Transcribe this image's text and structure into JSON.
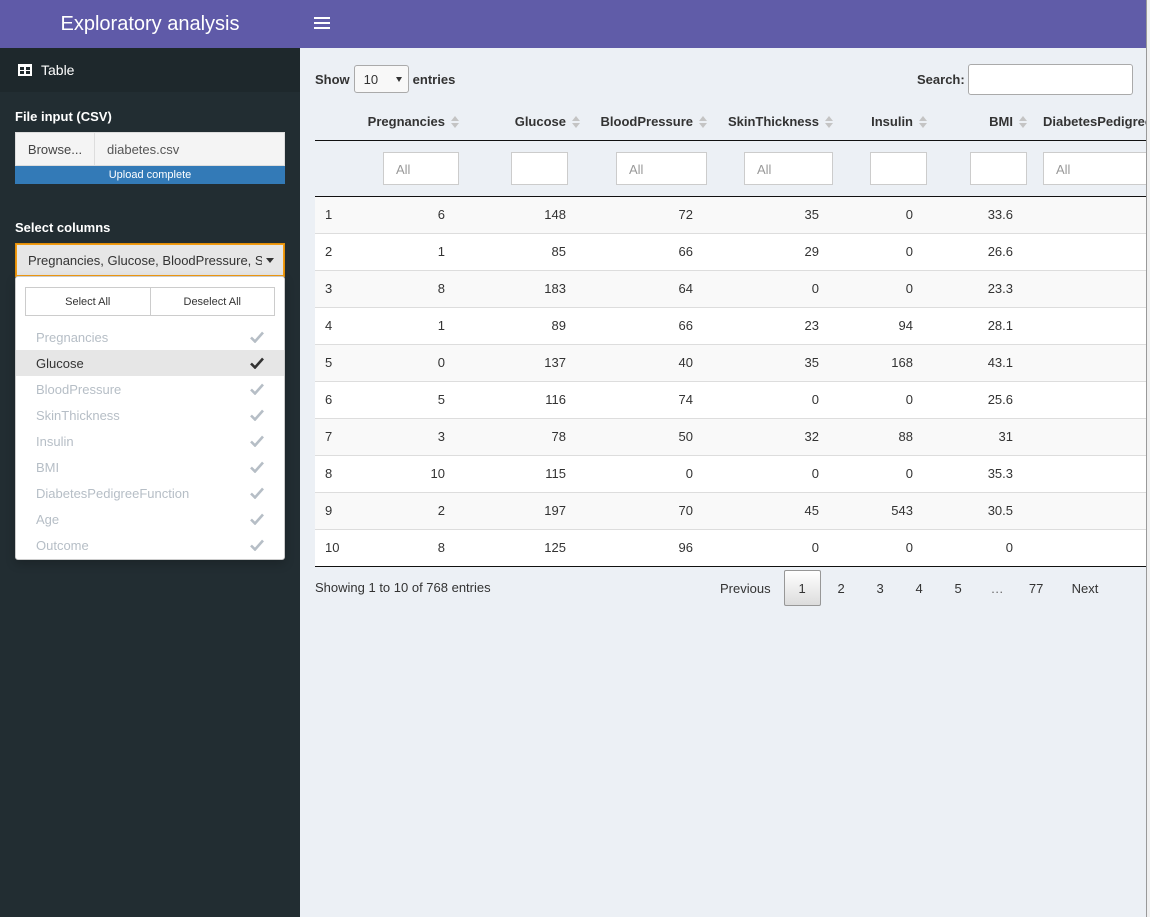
{
  "app": {
    "title": "Exploratory analysis"
  },
  "sidebar": {
    "menu_item": "Table",
    "file_input": {
      "label": "File input (CSV)",
      "browse_label": "Browse...",
      "file_name": "diabetes.csv",
      "progress_text": "Upload complete",
      "progress_value": 1.0
    },
    "select_columns": {
      "label": "Select columns",
      "selected_text": "Pregnancies, Glucose, BloodPressure, SkinThickness",
      "select_all": "Select All",
      "deselect_all": "Deselect All",
      "options": [
        {
          "label": "Pregnancies",
          "checked": true
        },
        {
          "label": "Glucose",
          "checked": true,
          "active": true
        },
        {
          "label": "BloodPressure",
          "checked": true
        },
        {
          "label": "SkinThickness",
          "checked": true
        },
        {
          "label": "Insulin",
          "checked": true
        },
        {
          "label": "BMI",
          "checked": true
        },
        {
          "label": "DiabetesPedigreeFunction",
          "checked": true
        },
        {
          "label": "Age",
          "checked": true
        },
        {
          "label": "Outcome",
          "checked": true
        }
      ]
    }
  },
  "table": {
    "show_label": "Show",
    "length_value": "10",
    "entries_label": "entries",
    "search_label": "Search:",
    "search_value": "",
    "columns": [
      "Pregnancies",
      "Glucose",
      "BloodPressure",
      "SkinThickness",
      "Insulin",
      "BMI",
      "DiabetesPedigreeFunction"
    ],
    "filter_placeholders": [
      "All",
      "",
      "All",
      "All",
      "",
      "",
      "All"
    ],
    "rows": [
      [
        "1",
        "6",
        "148",
        "72",
        "35",
        "0",
        "33.6",
        ""
      ],
      [
        "2",
        "1",
        "85",
        "66",
        "29",
        "0",
        "26.6",
        ""
      ],
      [
        "3",
        "8",
        "183",
        "64",
        "0",
        "0",
        "23.3",
        ""
      ],
      [
        "4",
        "1",
        "89",
        "66",
        "23",
        "94",
        "28.1",
        ""
      ],
      [
        "5",
        "0",
        "137",
        "40",
        "35",
        "168",
        "43.1",
        ""
      ],
      [
        "6",
        "5",
        "116",
        "74",
        "0",
        "0",
        "25.6",
        ""
      ],
      [
        "7",
        "3",
        "78",
        "50",
        "32",
        "88",
        "31",
        ""
      ],
      [
        "8",
        "10",
        "115",
        "0",
        "0",
        "0",
        "35.3",
        ""
      ],
      [
        "9",
        "2",
        "197",
        "70",
        "45",
        "543",
        "30.5",
        ""
      ],
      [
        "10",
        "8",
        "125",
        "96",
        "0",
        "0",
        "0",
        ""
      ]
    ],
    "info_text": "Showing 1 to 10 of 768 entries",
    "pagination": {
      "previous": "Previous",
      "pages": [
        "1",
        "2",
        "3",
        "4",
        "5",
        "…",
        "77"
      ],
      "current": "1",
      "next": "Next"
    }
  },
  "colors": {
    "header": "#605ca8",
    "sidebar": "#222d32",
    "progress": "#337ab7",
    "select_border": "#f39c12"
  }
}
